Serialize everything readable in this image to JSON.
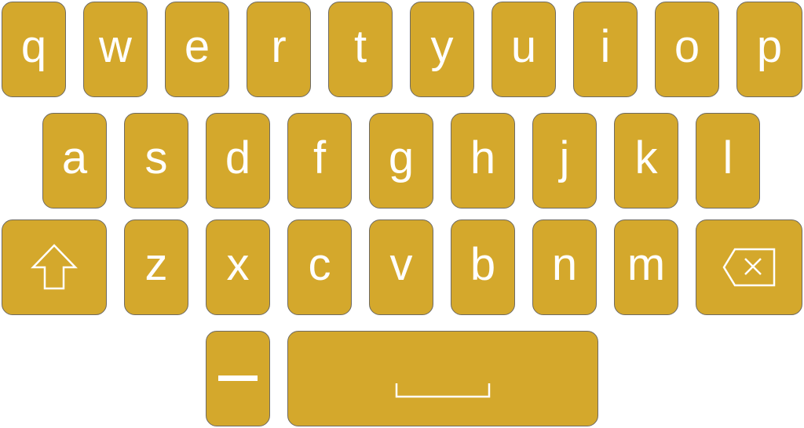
{
  "colors": {
    "key_fill": "#d4a82c",
    "key_border": "#6e6a62",
    "glyph": "#ffffff",
    "background": "#ffffff"
  },
  "rows": [
    {
      "name": "row-1",
      "keys": [
        "q",
        "w",
        "e",
        "r",
        "t",
        "y",
        "u",
        "i",
        "o",
        "p"
      ]
    },
    {
      "name": "row-2",
      "keys": [
        "a",
        "s",
        "d",
        "f",
        "g",
        "h",
        "j",
        "k",
        "l"
      ]
    },
    {
      "name": "row-3",
      "keys": [
        "z",
        "x",
        "c",
        "v",
        "b",
        "n",
        "m"
      ]
    }
  ],
  "special_keys": {
    "shift": {
      "icon": "shift-arrow-up-icon"
    },
    "backspace": {
      "icon": "backspace-icon"
    },
    "dash": {
      "icon": "dash-icon"
    },
    "space": {
      "icon": "space-bar-icon"
    }
  }
}
